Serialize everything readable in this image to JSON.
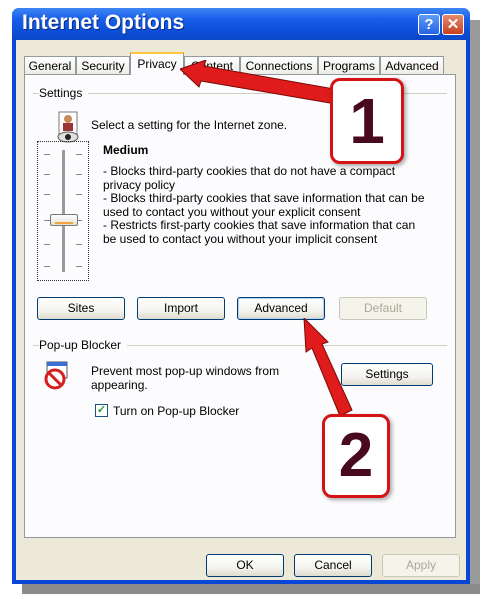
{
  "window": {
    "title": "Internet Options",
    "help_glyph": "?",
    "close_glyph": "✕"
  },
  "tabs": [
    {
      "label": "General"
    },
    {
      "label": "Security"
    },
    {
      "label": "Privacy",
      "active": true
    },
    {
      "label": "Content"
    },
    {
      "label": "Connections"
    },
    {
      "label": "Programs"
    },
    {
      "label": "Advanced"
    }
  ],
  "settings": {
    "group_label": "Settings",
    "instruction": "Select a setting for the Internet zone.",
    "level_name": "Medium",
    "slider_level": "Medium",
    "bullets": [
      "- Blocks third-party cookies that do not have a compact privacy policy",
      "- Blocks third-party cookies that save information that can be used to contact you without your explicit consent",
      "- Restricts first-party cookies that save information that can be used to contact you without your implicit consent"
    ],
    "buttons": {
      "sites": "Sites",
      "import": "Import",
      "advanced": "Advanced",
      "default": "Default"
    }
  },
  "popup": {
    "group_label": "Pop-up Blocker",
    "description": "Prevent most pop-up windows from appearing.",
    "settings_button": "Settings",
    "checkbox_label": "Turn on Pop-up Blocker",
    "checkbox_checked": true
  },
  "footer": {
    "ok": "OK",
    "cancel": "Cancel",
    "apply": "Apply"
  },
  "annotations": {
    "badge_1": "1",
    "badge_2": "2",
    "arrow_color": "#e01b1b"
  }
}
